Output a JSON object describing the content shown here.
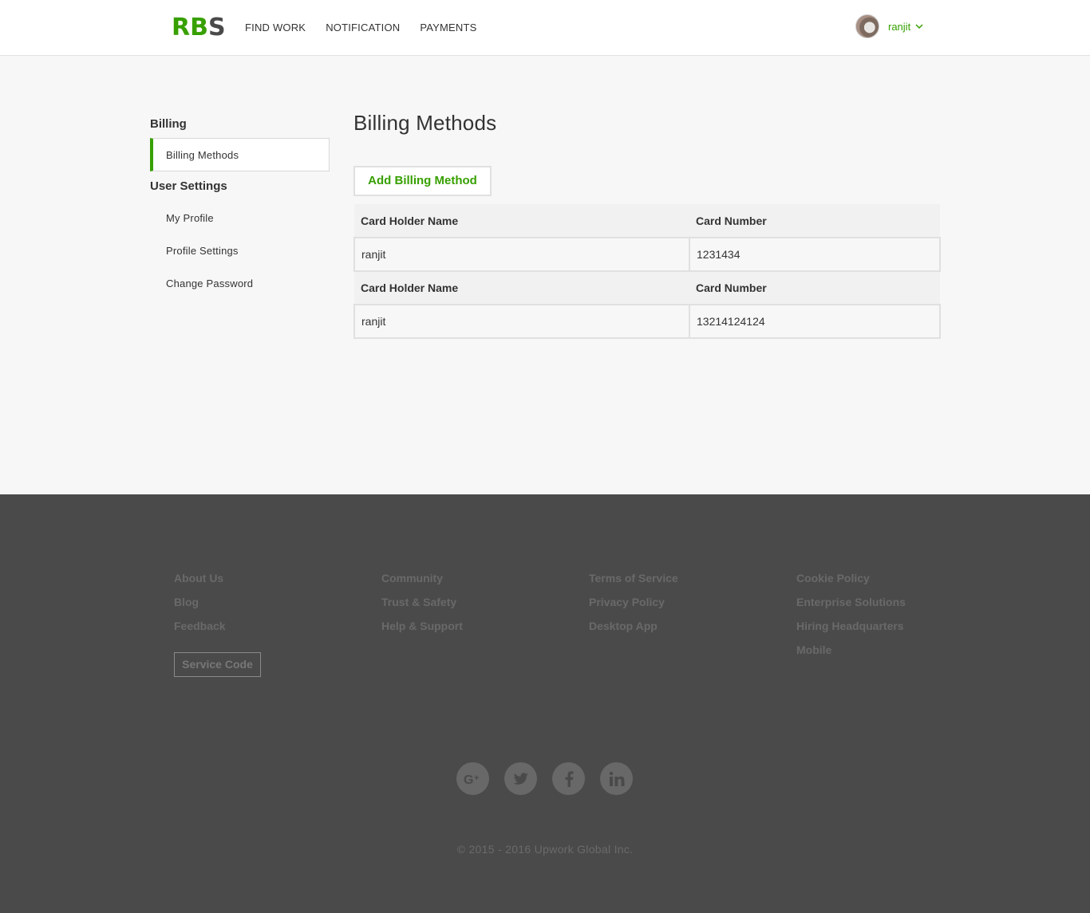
{
  "header": {
    "logo": {
      "part1": "R",
      "part2": "B",
      "part3": "S"
    },
    "nav": [
      "FIND WORK",
      "NOTIFICATION",
      "PAYMENTS"
    ],
    "user": {
      "name": "ranjit"
    }
  },
  "sidebar": {
    "billing_heading": "Billing",
    "billing_items": [
      "Billing Methods"
    ],
    "user_settings_heading": "User Settings",
    "user_settings_items": [
      "My Profile",
      "Profile Settings",
      "Change Password"
    ]
  },
  "main": {
    "title": "Billing Methods",
    "add_button": "Add Billing Method",
    "columns": [
      "Card Holder Name",
      "Card Number"
    ],
    "cards": [
      {
        "holder": "ranjit",
        "number": "1231434"
      },
      {
        "holder": "ranjit",
        "number": "13214124124"
      }
    ]
  },
  "footer": {
    "col1": [
      "About Us",
      "Blog",
      "Feedback"
    ],
    "col2": [
      "Community",
      "Trust & Safety",
      "Help & Support"
    ],
    "col3": [
      "Terms of Service",
      "Privacy Policy",
      "Desktop App"
    ],
    "col4": [
      "Cookie Policy",
      "Enterprise Solutions",
      "Hiring Headquarters",
      "Mobile"
    ],
    "service_code": "Service Code",
    "social_icons": [
      "google-plus-icon",
      "twitter-icon",
      "facebook-icon",
      "linkedin-icon"
    ],
    "copyright": "© 2015 - 2016 Upwork Global Inc."
  },
  "colors": {
    "accent": "#37a000",
    "footer_bg": "#4a4a4a",
    "page_bg": "#f7f7f7"
  }
}
